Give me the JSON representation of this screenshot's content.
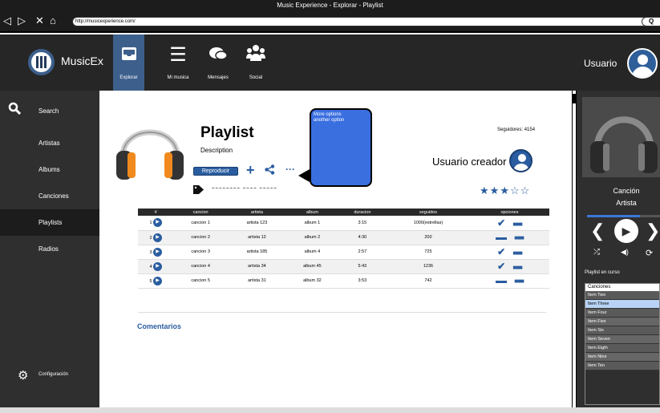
{
  "window": {
    "title": "Music Experience - Explorar - Playlist",
    "url": "http://musicexperience.com/",
    "nav": {
      "back": "◁",
      "forward": "▷",
      "close": "✕",
      "home": "⌂"
    },
    "search_glyph": "Q"
  },
  "brand": {
    "name": "MusicEx"
  },
  "topnav": {
    "tabs": [
      {
        "icon": "inbox-icon",
        "label": "Explorar"
      },
      {
        "icon": "list-icon",
        "label": "Mi musica"
      },
      {
        "icon": "chat-icon",
        "label": "Mensajes"
      },
      {
        "icon": "group-icon",
        "label": "Social"
      }
    ],
    "user": "Usuario"
  },
  "sidebar": {
    "search": "Search",
    "items": [
      "Artistas",
      "Albums",
      "Canciones",
      "Playlists",
      "Radios"
    ],
    "config": "Configuración"
  },
  "playlist": {
    "title": "Playlist",
    "description": "Description",
    "play": "Reproducir",
    "followers": "Seguidores: 4154",
    "creator": "Usuario creador",
    "rating": 3,
    "tags": "~~~~~~~~ ~~~~ ~~~~~"
  },
  "tooltip": {
    "lines": [
      "More options",
      "another option"
    ]
  },
  "table": {
    "headers": [
      "#",
      "cancion",
      "artista",
      "album",
      "duracion",
      "seguidos",
      "opciones"
    ],
    "rows": [
      {
        "n": "1",
        "cancion": "cancion 1",
        "artista": "artista 123",
        "album": "album 1",
        "duracion": "3:15",
        "seguidos": "1000(estrellas)",
        "opt": "check"
      },
      {
        "n": "2",
        "cancion": "cancion 2",
        "artista": "artista 12",
        "album": "album 2",
        "duracion": "4:30",
        "seguidos": "200",
        "opt": "minus"
      },
      {
        "n": "3",
        "cancion": "cancion 3",
        "artista": "artista 185",
        "album": "album 4",
        "duracion": "2:57",
        "seguidos": "725",
        "opt": "check"
      },
      {
        "n": "4",
        "cancion": "cancion 4",
        "artista": "artista 34",
        "album": "album 45",
        "duracion": "5:43",
        "seguidos": "1236",
        "opt": "check"
      },
      {
        "n": "5",
        "cancion": "cancion 5",
        "artista": "artista 31",
        "album": "album 32",
        "duracion": "3:53",
        "seguidos": "742",
        "opt": "minus"
      }
    ]
  },
  "comments": "Comentarios",
  "player": {
    "song": "Canción",
    "artist": "Artista",
    "progress": 0.6,
    "current_label": "Playlist en curso",
    "list_header": "Canciones",
    "items": [
      "Item Two",
      "Item Three",
      "Item Four",
      "Item Five",
      "Item Six",
      "Item Seven",
      "Item Eigth",
      "Item Nine",
      "Item Ten"
    ],
    "selected": "Item Three"
  },
  "colors": {
    "accent": "#2a5da0",
    "nav_bg": "#262626",
    "sidebar_bg": "#2f2f2f",
    "tooltip": "#3a6fe0"
  }
}
